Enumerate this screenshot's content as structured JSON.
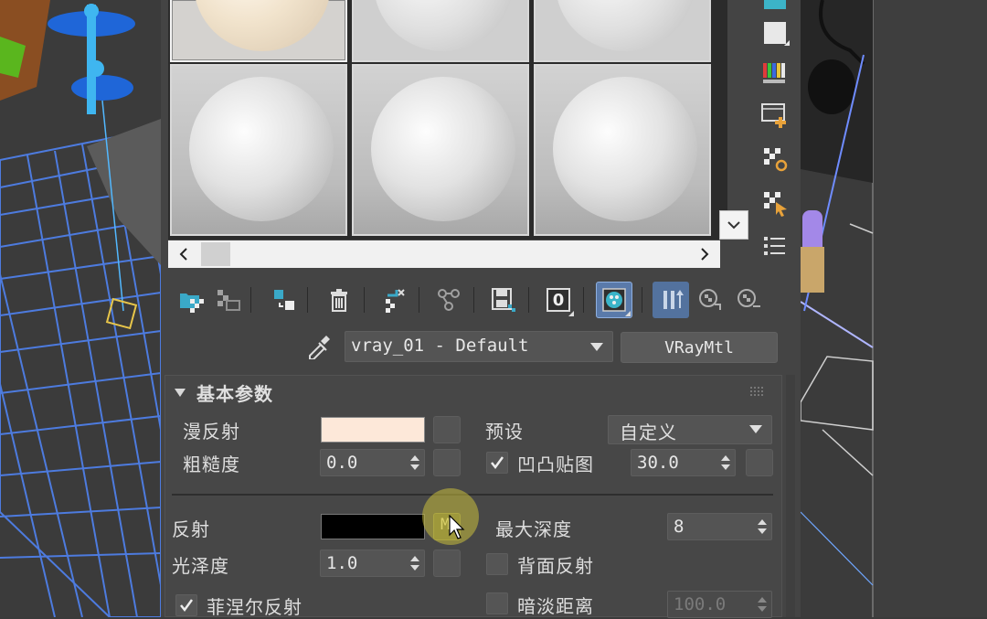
{
  "toolbar_labels": {
    "assign_zero": "0"
  },
  "material_name": "vray_01 - Default",
  "material_type": "VRayMtl",
  "panel": {
    "title": "基本参数",
    "diffuse": {
      "label": "漫反射",
      "color": "#fde8d9"
    },
    "preset": {
      "label": "预设",
      "value": "自定义"
    },
    "roughness": {
      "label": "粗糙度",
      "value": "0.0"
    },
    "bump": {
      "label": "凹凸贴图",
      "value": "30.0",
      "checked": true
    },
    "reflect": {
      "label": "反射",
      "color": "#000000",
      "map_label": "M"
    },
    "max_depth": {
      "label": "最大深度",
      "value": "8"
    },
    "glossiness": {
      "label": "光泽度",
      "value": "1.0"
    },
    "back_reflect": {
      "label": "背面反射",
      "checked": false
    },
    "fresnel": {
      "label": "菲涅尔反射",
      "checked": true
    },
    "dim_distance": {
      "label": "暗淡距离",
      "value": "100.0",
      "checked": false
    }
  },
  "colors": {
    "viewport_bg": "#3a3a3a",
    "panel_bg": "#444444",
    "wire_blue": "#4e8bff",
    "accent_blue": "#6d8fc9"
  }
}
